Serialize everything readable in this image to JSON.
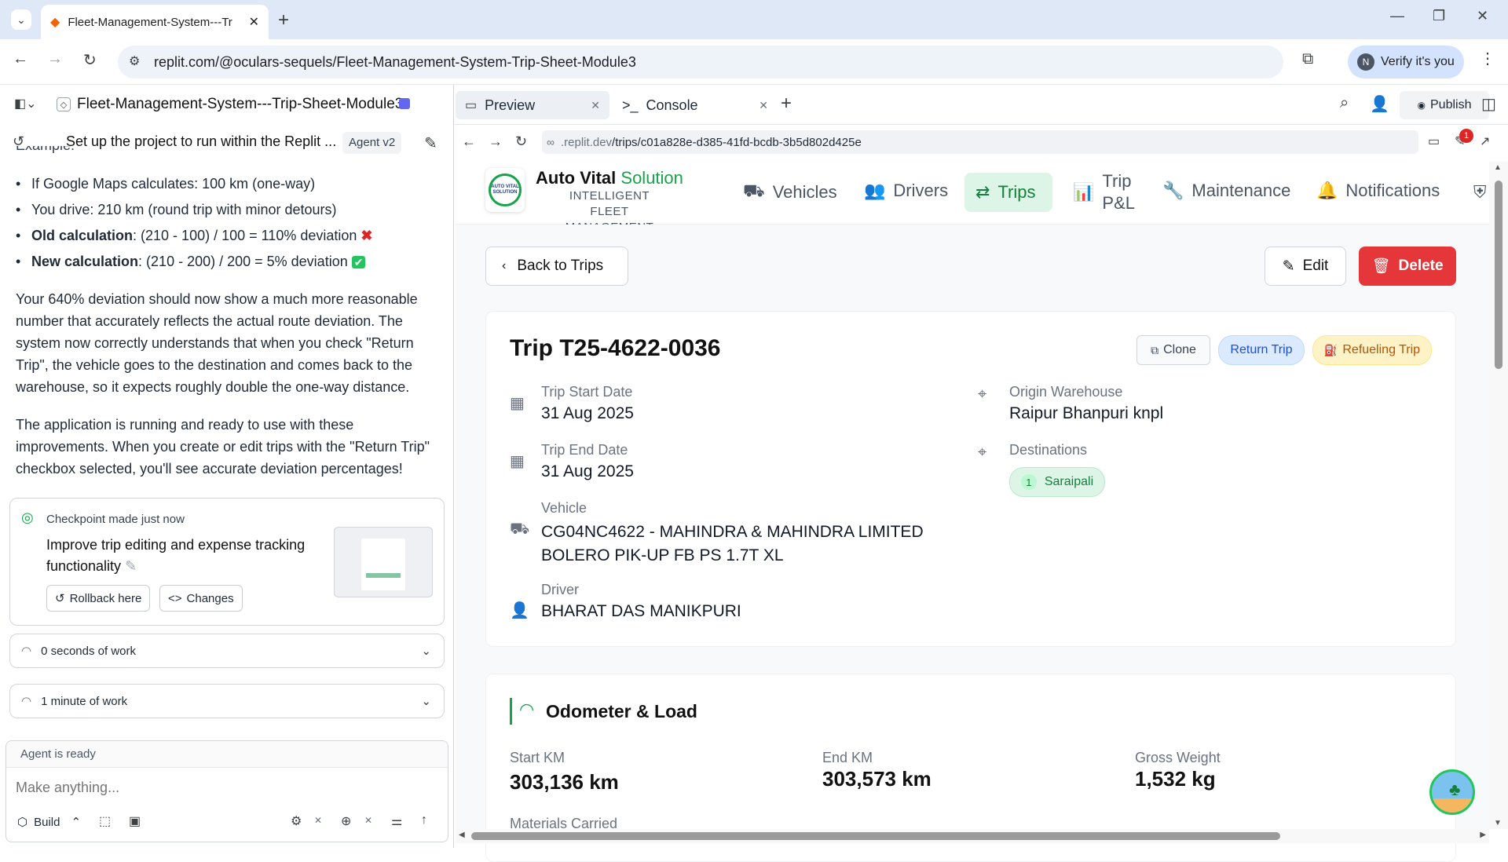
{
  "browser": {
    "tab_title": "Fleet-Management-System---Tr",
    "url": "replit.com/@oculars-sequels/Fleet-Management-System-Trip-Sheet-Module3",
    "profile_initial": "N",
    "verify_label": "Verify it's you"
  },
  "replit": {
    "project_name": "Fleet-Management-System---Trip-Sheet-Module3",
    "preview_tab": "Preview",
    "console_tab": "Console",
    "publish_label": "Publish",
    "preview_url_host": ".replit.dev",
    "preview_url_path": "/trips/c01a828e-d385-41fd-bcdb-3b5d802d425e",
    "notification_count": "1"
  },
  "agent": {
    "task_title": "Set up the project to run within the Replit ...",
    "agent_version": "Agent v2",
    "cut_line": "Example:",
    "bullets": [
      {
        "bold": "",
        "text": "If Google Maps calculates: 100 km (one-way)",
        "mark": ""
      },
      {
        "bold": "",
        "text": "You drive: 210 km (round trip with minor detours)",
        "mark": ""
      },
      {
        "bold": "Old calculation",
        "text": ": (210 - 100) / 100 = 110% deviation",
        "mark": "✖"
      },
      {
        "bold": "New calculation",
        "text": ": (210 - 200) / 200 = 5% deviation",
        "mark": "✔"
      }
    ],
    "para1": "Your 640% deviation should now show a much more reasonable number that accurately reflects the actual route deviation. The system now correctly understands that when you check \"Return Trip\", the vehicle goes to the destination and comes back to the warehouse, so it expects roughly double the one-way distance.",
    "para2": "The application is running and ready to use with these improvements. When you create or edit trips with the \"Return Trip\" checkbox selected, you'll see accurate deviation percentages!",
    "checkpoint_label": "Checkpoint made",
    "checkpoint_time": "just now",
    "checkpoint_title": "Improve trip editing and expense tracking functionality",
    "rollback_label": "Rollback here",
    "changes_label": "Changes",
    "work1": "0 seconds of work",
    "work2": "1 minute of work",
    "status": "Agent is ready",
    "input_placeholder": "Make anything...",
    "build_label": "Build"
  },
  "app": {
    "brand_1": "Auto Vital",
    "brand_2": "Solution",
    "brand_sub": "INTELLIGENT FLEET MANAGEMENT",
    "logo_text": "AUTO VITAL SOLUTION",
    "nav": [
      {
        "label": "Vehicles",
        "icon": "truck-icon"
      },
      {
        "label": "Drivers",
        "icon": "users-icon"
      },
      {
        "label": "Trips",
        "icon": "route-icon"
      },
      {
        "label": "Trip P&L",
        "icon": "bar-chart-icon"
      },
      {
        "label": "Maintenance",
        "icon": "wrench-icon"
      },
      {
        "label": "Notifications",
        "icon": "bell-icon"
      }
    ],
    "back_label": "Back to Trips",
    "edit_label": "Edit",
    "delete_label": "Delete",
    "trip_title": "Trip T25-4622-0036",
    "clone_label": "Clone",
    "return_trip_badge": "Return Trip",
    "refueling_badge": "Refueling Trip",
    "start_date_label": "Trip Start Date",
    "start_date": "31 Aug 2025",
    "end_date_label": "Trip End Date",
    "end_date": "31 Aug 2025",
    "vehicle_label": "Vehicle",
    "vehicle_line1": "CG04NC4622 - MAHINDRA & MAHINDRA LIMITED",
    "vehicle_line2": "BOLERO PIK-UP FB PS 1.7T XL",
    "driver_label": "Driver",
    "driver": "BHARAT DAS MANIKPURI",
    "origin_label": "Origin Warehouse",
    "origin": "Raipur Bhanpuri knpl",
    "destinations_label": "Destinations",
    "destination_num": "1",
    "destination": "Saraipali",
    "odometer_title": "Odometer & Load",
    "start_km_label": "Start KM",
    "start_km": "303,136 km",
    "end_km_label": "End KM",
    "end_km": "303,573 km",
    "gross_label": "Gross Weight",
    "gross": "1,532 kg",
    "materials_label": "Materials Carried"
  },
  "colors": {
    "accent": "#16a34a",
    "danger": "#e5373a",
    "blue_pill": "#dbeafe",
    "amber_pill": "#fef3c7"
  }
}
